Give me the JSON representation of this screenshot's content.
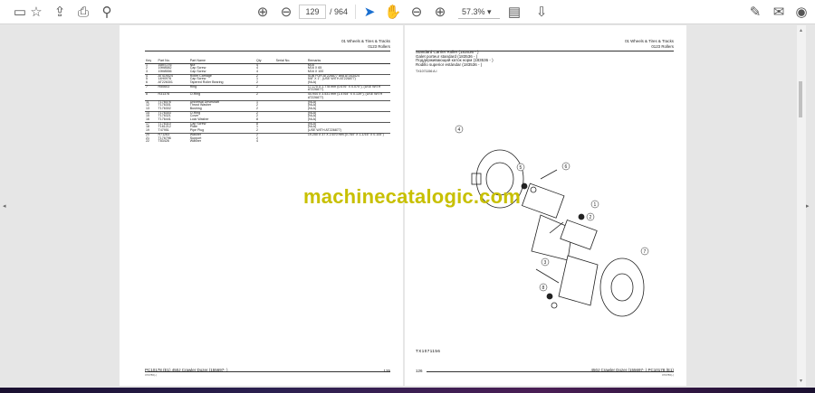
{
  "toolbar": {
    "current_page": "129",
    "page_count": "/ 964",
    "zoom": "57.3%",
    "icons": [
      "save-icon",
      "star-icon",
      "upload-icon",
      "print-icon",
      "search-icon",
      "page-up-icon",
      "page-down-icon",
      "select-cursor-icon",
      "hand-icon",
      "zoom-out-icon",
      "zoom-in-icon",
      "page-layout-icon",
      "scroll-mode-icon",
      "sign-icon",
      "email-icon",
      "account-icon"
    ]
  },
  "left_page": {
    "header_line1": "01 Wheels & Tires & Tracks",
    "header_line2": "0123 Rollers",
    "columns": [
      "Key",
      "Part No.",
      "Part Name",
      "Qty",
      "Serial No.",
      "Remarks"
    ],
    "rows": [
      [
        "1",
        "16M7276",
        "Nut",
        "4",
        "",
        "M16"
      ],
      [
        "2",
        "19M8582",
        "Cap Screw",
        "4",
        "",
        "M16 X 65"
      ],
      [
        "3",
        "19M8556",
        "Cap Screw",
        "4",
        "",
        "M16 X 100"
      ],
      [
        "4",
        "AT419024",
        "Roller Carriage",
        "2",
        "",
        "SUB FOR AT226877 and AT343424"
      ],
      [
        "5",
        "14H0976",
        "Cap Screw",
        "1",
        "",
        "5/8\" X 1\", (USE WITH AT226877)"
      ],
      [
        "6",
        "AT226301",
        "Tapered Roller Bearing",
        "2",
        "",
        "(NLA)"
      ],
      [
        "7",
        "R50603",
        "Ring",
        "2",
        "",
        "17.170 X 1.778 mm (0.676\" X 0.070\"), (USE WITH AT226877)"
      ],
      [
        "8",
        "R31376",
        "O-Ring",
        "2",
        "",
        "44.944 X 3.531 mm (1.4764\" X 0.139\"), (USE WITH AT226877)"
      ],
      [
        "11",
        "T176076",
        "Universal Driveshaft",
        "1",
        "",
        "(NLA)"
      ],
      [
        "12",
        "T176301",
        "Thrust Washer",
        "2",
        "",
        "(NLA)"
      ],
      [
        "13",
        "T176302",
        "Bushing",
        "2",
        "",
        "(NLA)"
      ],
      [
        "14",
        "T176303",
        "O-Ring",
        "2",
        "",
        "(NLA)"
      ],
      [
        "15",
        "T176321",
        "Cover",
        "2",
        "",
        "(NLA)"
      ],
      [
        "16",
        "T176441",
        "Lock Washer",
        "8",
        "",
        "(NLA)"
      ],
      [
        "17",
        "T176310",
        "Cap Screw",
        "8",
        "",
        "(NLA)"
      ],
      [
        "18",
        "T161212",
        "Plate",
        "1",
        "",
        "(NLA)"
      ],
      [
        "19",
        "T47951",
        "Pipe Plug",
        "2",
        "",
        "(USE WITH AT226877)"
      ],
      [
        "20",
        "R71263",
        "Washer",
        "2",
        "",
        "19.250 X 37 X 2.670 mm (0.764\" X 1-1/16\" X 0.105\")"
      ],
      [
        "21",
        "T176796",
        "Support",
        "2",
        "",
        ""
      ],
      [
        "22",
        "T83426",
        "Washer",
        "4",
        "",
        ""
      ]
    ],
    "footer_left": "PC10178 (E1)   450J Crawler Dozer (155697- )",
    "footer_sub": "070786(-)",
    "page_number": "125"
  },
  "right_page": {
    "header_line1": "01 Wheels & Tires & Tracks",
    "header_line2": "0123 Rollers",
    "titles": [
      "Standard Carrier Roller (183536 - )",
      "Galet porteur standard (183536 - )",
      "Поддерживающий каток норм (183536 - )",
      "Rodillo superior estándar (183536 - )"
    ],
    "figure_ref": "TX1071156 A.I",
    "figure_code": "TX1071156",
    "callouts": [
      "4",
      "5",
      "6",
      "1",
      "2",
      "3",
      "8",
      "7"
    ],
    "footer_right": "450J Crawler Dozer (155697- )   PC10178 (E1)",
    "footer_sub": "070786(-)",
    "page_number": "126"
  },
  "watermark": "machinecatalogic.com"
}
